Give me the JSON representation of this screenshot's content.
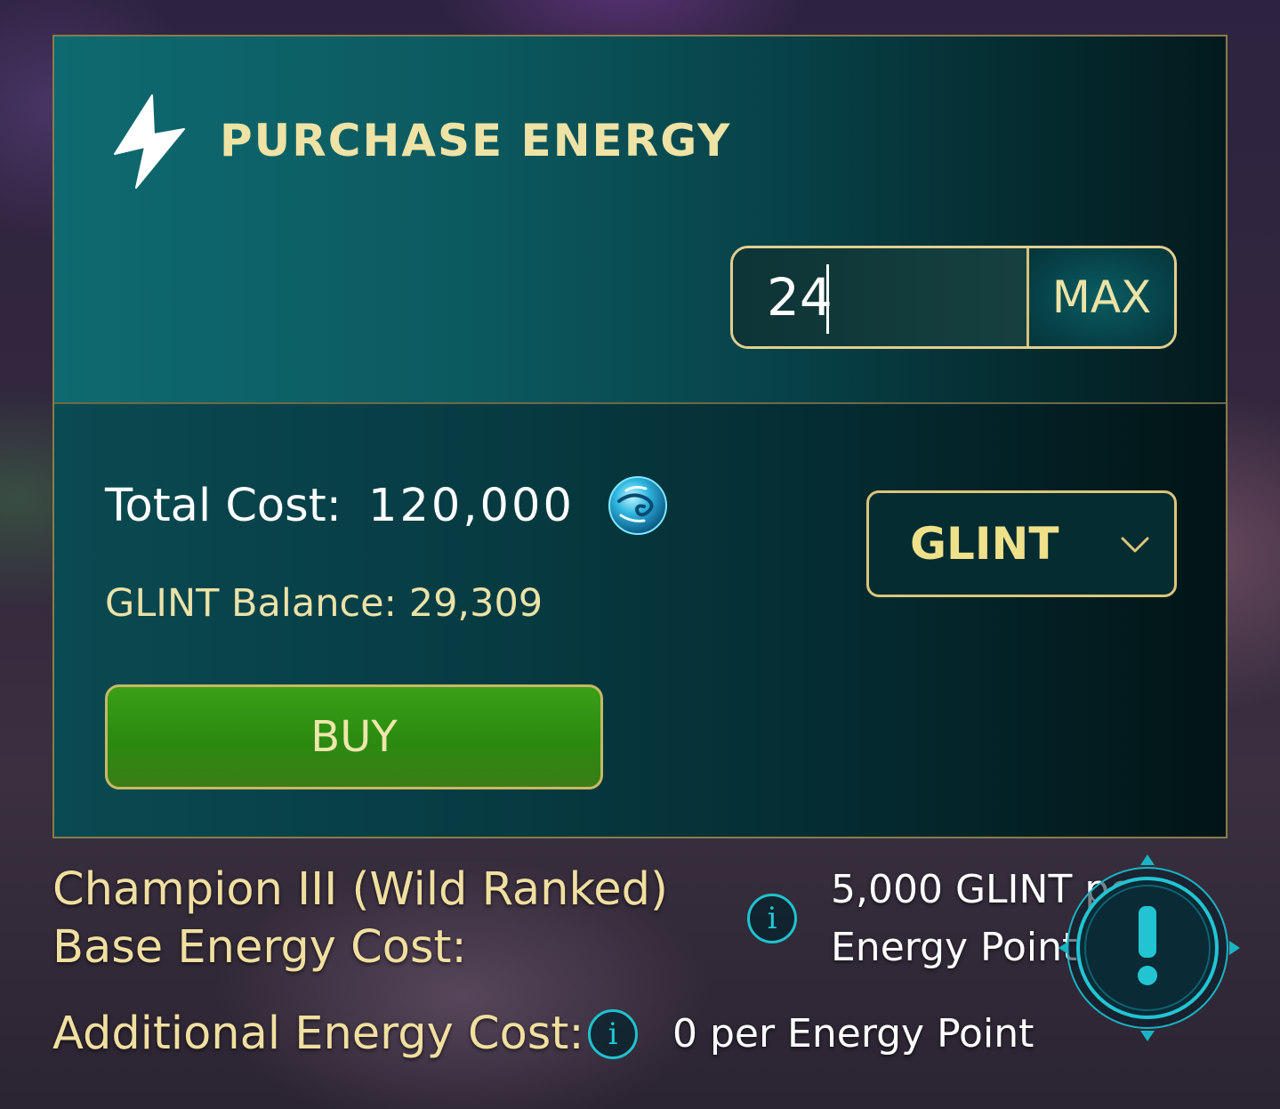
{
  "panel": {
    "title": "PURCHASE ENERGY",
    "quantity_value": "24",
    "max_label": "MAX",
    "total_cost_label": "Total Cost:",
    "total_cost_value": "120,000",
    "balance_text": "GLINT Balance: 29,309",
    "buy_label": "BUY",
    "currency_selected": "GLINT"
  },
  "info": {
    "base_label_line1": "Champion III (Wild Ranked)",
    "base_label_line2": "Base Energy Cost:",
    "base_value_line1": "5,000 GLINT per",
    "base_value_line2": "Energy Point",
    "additional_label": "Additional Energy Cost:",
    "additional_value": "0 per Energy Point",
    "info_glyph": "i"
  },
  "colors": {
    "accent_gold": "#eee3a5",
    "teal": "#0e6a70",
    "buy_green": "#2b8a10",
    "info_cyan": "#1ec3cf"
  },
  "icons": [
    "lightning-bolt-icon",
    "glint-orb-icon",
    "chevron-down-icon",
    "info-icon",
    "alert-exclamation-icon"
  ]
}
